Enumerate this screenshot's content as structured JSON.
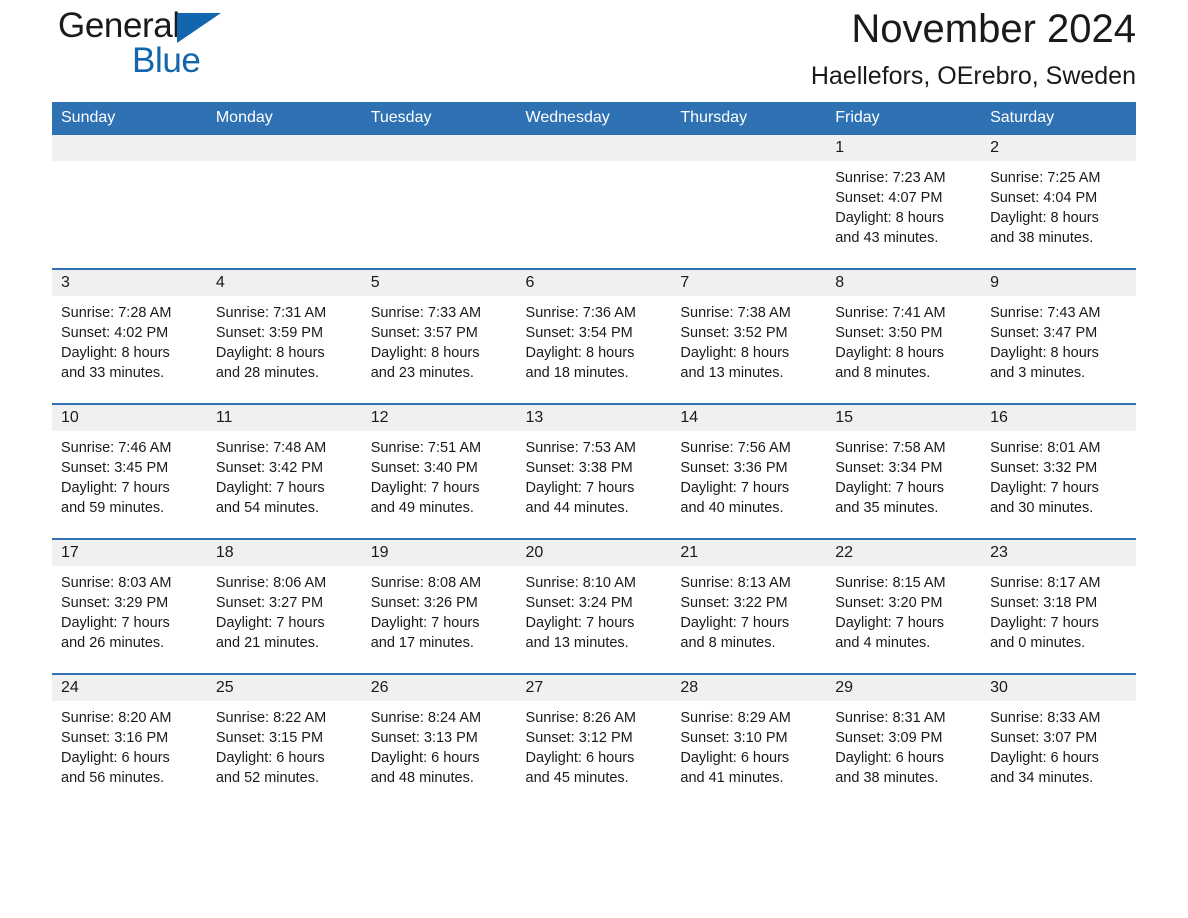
{
  "brand": {
    "name_part1": "General",
    "name_part2": "Blue",
    "triangle_color": "#1266ad"
  },
  "header": {
    "title": "November 2024",
    "subtitle": "Haellefors, OErebro, Sweden"
  },
  "theme": {
    "header_blue": "#2f72b4",
    "daynum_band": "#f0f0f0",
    "text": "#1a1a1a",
    "page_bg": "#ffffff"
  },
  "calendar": {
    "weekday_headers": [
      "Sunday",
      "Monday",
      "Tuesday",
      "Wednesday",
      "Thursday",
      "Friday",
      "Saturday"
    ],
    "weeks": [
      [
        {
          "day": "",
          "lines": [
            "",
            "",
            "",
            ""
          ],
          "empty": true
        },
        {
          "day": "",
          "lines": [
            "",
            "",
            "",
            ""
          ],
          "empty": true
        },
        {
          "day": "",
          "lines": [
            "",
            "",
            "",
            ""
          ],
          "empty": true
        },
        {
          "day": "",
          "lines": [
            "",
            "",
            "",
            ""
          ],
          "empty": true
        },
        {
          "day": "",
          "lines": [
            "",
            "",
            "",
            ""
          ],
          "empty": true
        },
        {
          "day": "1",
          "lines": [
            "Sunrise: 7:23 AM",
            "Sunset: 4:07 PM",
            "Daylight: 8 hours",
            "and 43 minutes."
          ],
          "empty": false
        },
        {
          "day": "2",
          "lines": [
            "Sunrise: 7:25 AM",
            "Sunset: 4:04 PM",
            "Daylight: 8 hours",
            "and 38 minutes."
          ],
          "empty": false
        }
      ],
      [
        {
          "day": "3",
          "lines": [
            "Sunrise: 7:28 AM",
            "Sunset: 4:02 PM",
            "Daylight: 8 hours",
            "and 33 minutes."
          ],
          "empty": false
        },
        {
          "day": "4",
          "lines": [
            "Sunrise: 7:31 AM",
            "Sunset: 3:59 PM",
            "Daylight: 8 hours",
            "and 28 minutes."
          ],
          "empty": false
        },
        {
          "day": "5",
          "lines": [
            "Sunrise: 7:33 AM",
            "Sunset: 3:57 PM",
            "Daylight: 8 hours",
            "and 23 minutes."
          ],
          "empty": false
        },
        {
          "day": "6",
          "lines": [
            "Sunrise: 7:36 AM",
            "Sunset: 3:54 PM",
            "Daylight: 8 hours",
            "and 18 minutes."
          ],
          "empty": false
        },
        {
          "day": "7",
          "lines": [
            "Sunrise: 7:38 AM",
            "Sunset: 3:52 PM",
            "Daylight: 8 hours",
            "and 13 minutes."
          ],
          "empty": false
        },
        {
          "day": "8",
          "lines": [
            "Sunrise: 7:41 AM",
            "Sunset: 3:50 PM",
            "Daylight: 8 hours",
            "and 8 minutes."
          ],
          "empty": false
        },
        {
          "day": "9",
          "lines": [
            "Sunrise: 7:43 AM",
            "Sunset: 3:47 PM",
            "Daylight: 8 hours",
            "and 3 minutes."
          ],
          "empty": false
        }
      ],
      [
        {
          "day": "10",
          "lines": [
            "Sunrise: 7:46 AM",
            "Sunset: 3:45 PM",
            "Daylight: 7 hours",
            "and 59 minutes."
          ],
          "empty": false
        },
        {
          "day": "11",
          "lines": [
            "Sunrise: 7:48 AM",
            "Sunset: 3:42 PM",
            "Daylight: 7 hours",
            "and 54 minutes."
          ],
          "empty": false
        },
        {
          "day": "12",
          "lines": [
            "Sunrise: 7:51 AM",
            "Sunset: 3:40 PM",
            "Daylight: 7 hours",
            "and 49 minutes."
          ],
          "empty": false
        },
        {
          "day": "13",
          "lines": [
            "Sunrise: 7:53 AM",
            "Sunset: 3:38 PM",
            "Daylight: 7 hours",
            "and 44 minutes."
          ],
          "empty": false
        },
        {
          "day": "14",
          "lines": [
            "Sunrise: 7:56 AM",
            "Sunset: 3:36 PM",
            "Daylight: 7 hours",
            "and 40 minutes."
          ],
          "empty": false
        },
        {
          "day": "15",
          "lines": [
            "Sunrise: 7:58 AM",
            "Sunset: 3:34 PM",
            "Daylight: 7 hours",
            "and 35 minutes."
          ],
          "empty": false
        },
        {
          "day": "16",
          "lines": [
            "Sunrise: 8:01 AM",
            "Sunset: 3:32 PM",
            "Daylight: 7 hours",
            "and 30 minutes."
          ],
          "empty": false
        }
      ],
      [
        {
          "day": "17",
          "lines": [
            "Sunrise: 8:03 AM",
            "Sunset: 3:29 PM",
            "Daylight: 7 hours",
            "and 26 minutes."
          ],
          "empty": false
        },
        {
          "day": "18",
          "lines": [
            "Sunrise: 8:06 AM",
            "Sunset: 3:27 PM",
            "Daylight: 7 hours",
            "and 21 minutes."
          ],
          "empty": false
        },
        {
          "day": "19",
          "lines": [
            "Sunrise: 8:08 AM",
            "Sunset: 3:26 PM",
            "Daylight: 7 hours",
            "and 17 minutes."
          ],
          "empty": false
        },
        {
          "day": "20",
          "lines": [
            "Sunrise: 8:10 AM",
            "Sunset: 3:24 PM",
            "Daylight: 7 hours",
            "and 13 minutes."
          ],
          "empty": false
        },
        {
          "day": "21",
          "lines": [
            "Sunrise: 8:13 AM",
            "Sunset: 3:22 PM",
            "Daylight: 7 hours",
            "and 8 minutes."
          ],
          "empty": false
        },
        {
          "day": "22",
          "lines": [
            "Sunrise: 8:15 AM",
            "Sunset: 3:20 PM",
            "Daylight: 7 hours",
            "and 4 minutes."
          ],
          "empty": false
        },
        {
          "day": "23",
          "lines": [
            "Sunrise: 8:17 AM",
            "Sunset: 3:18 PM",
            "Daylight: 7 hours",
            "and 0 minutes."
          ],
          "empty": false
        }
      ],
      [
        {
          "day": "24",
          "lines": [
            "Sunrise: 8:20 AM",
            "Sunset: 3:16 PM",
            "Daylight: 6 hours",
            "and 56 minutes."
          ],
          "empty": false
        },
        {
          "day": "25",
          "lines": [
            "Sunrise: 8:22 AM",
            "Sunset: 3:15 PM",
            "Daylight: 6 hours",
            "and 52 minutes."
          ],
          "empty": false
        },
        {
          "day": "26",
          "lines": [
            "Sunrise: 8:24 AM",
            "Sunset: 3:13 PM",
            "Daylight: 6 hours",
            "and 48 minutes."
          ],
          "empty": false
        },
        {
          "day": "27",
          "lines": [
            "Sunrise: 8:26 AM",
            "Sunset: 3:12 PM",
            "Daylight: 6 hours",
            "and 45 minutes."
          ],
          "empty": false
        },
        {
          "day": "28",
          "lines": [
            "Sunrise: 8:29 AM",
            "Sunset: 3:10 PM",
            "Daylight: 6 hours",
            "and 41 minutes."
          ],
          "empty": false
        },
        {
          "day": "29",
          "lines": [
            "Sunrise: 8:31 AM",
            "Sunset: 3:09 PM",
            "Daylight: 6 hours",
            "and 38 minutes."
          ],
          "empty": false
        },
        {
          "day": "30",
          "lines": [
            "Sunrise: 8:33 AM",
            "Sunset: 3:07 PM",
            "Daylight: 6 hours",
            "and 34 minutes."
          ],
          "empty": false
        }
      ]
    ]
  }
}
